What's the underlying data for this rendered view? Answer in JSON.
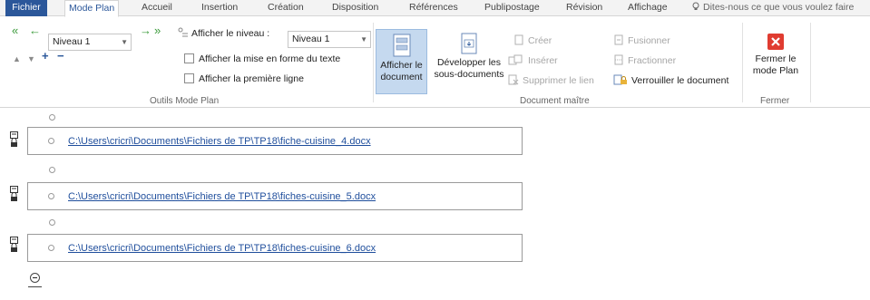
{
  "tabs": [
    {
      "label": "Fichier"
    },
    {
      "label": "Mode Plan"
    },
    {
      "label": "Accueil"
    },
    {
      "label": "Insertion"
    },
    {
      "label": "Création"
    },
    {
      "label": "Disposition"
    },
    {
      "label": "Références"
    },
    {
      "label": "Publipostage"
    },
    {
      "label": "Révision"
    },
    {
      "label": "Affichage"
    }
  ],
  "tell_me": "Dites-nous ce que vous voulez faire",
  "outline_tools": {
    "level_value": "Niveau 1",
    "show_level_label": "Afficher le niveau :",
    "show_level_value": "Niveau 1",
    "show_formatting": "Afficher la mise en forme du texte",
    "show_first_line": "Afficher la première ligne",
    "group_label": "Outils Mode Plan"
  },
  "master_doc": {
    "show_document": "Afficher le document",
    "show_document_l1": "Afficher le",
    "show_document_l2": "document",
    "expand_subdocs_l1": "Développer les",
    "expand_subdocs_l2": "sous-documents",
    "create": "Créer",
    "insert": "Insérer",
    "unlink": "Supprimer le lien",
    "merge": "Fusionner",
    "split": "Fractionner",
    "lock_document": "Verrouiller le document",
    "group_label": "Document maître"
  },
  "close": {
    "label_l1": "Fermer le",
    "label_l2": "mode Plan",
    "group_label": "Fermer"
  },
  "subdocuments": [
    {
      "path": "C:\\Users\\cricri\\Documents\\Fichiers de TP\\TP18\\fiche-cuisine_4.docx"
    },
    {
      "path": "C:\\Users\\cricri\\Documents\\Fichiers de TP\\TP18\\fiches-cuisine_5.docx"
    },
    {
      "path": "C:\\Users\\cricri\\Documents\\Fichiers de TP\\TP18\\fiches-cuisine_6.docx"
    }
  ],
  "colors": {
    "accent": "#2b579a",
    "link": "#1f4e9c",
    "close_red": "#e03c31",
    "pressed_bg": "#c5d9ef"
  }
}
